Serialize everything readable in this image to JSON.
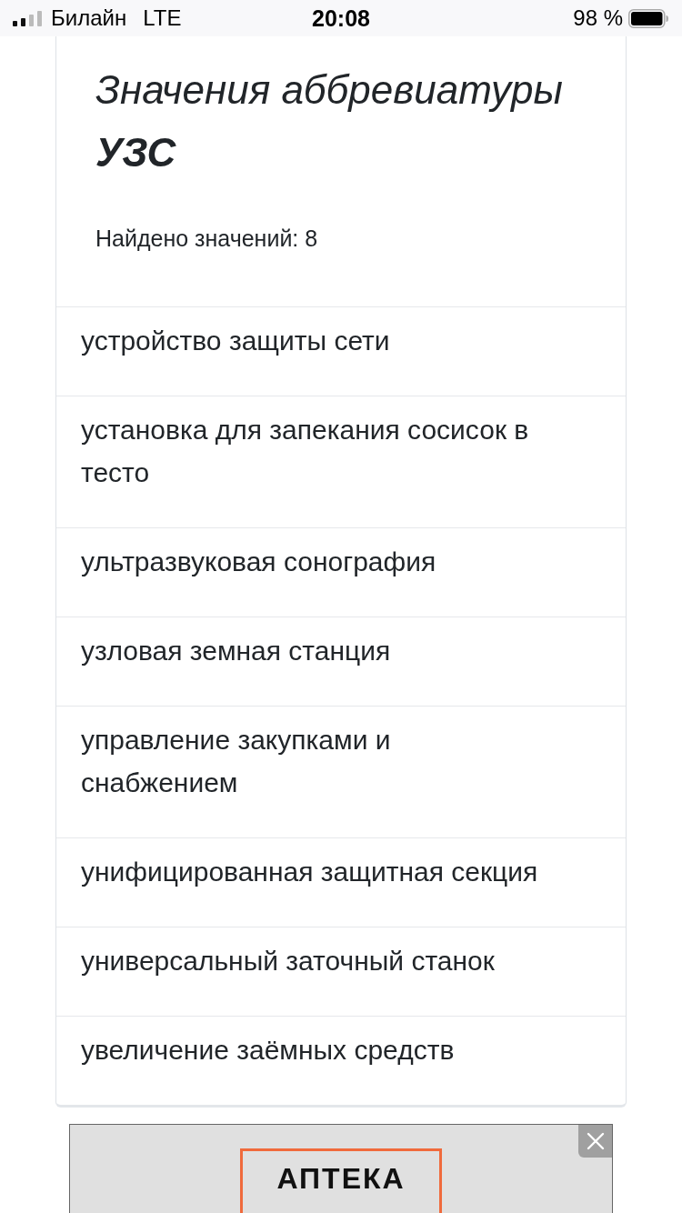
{
  "status_bar": {
    "carrier": "Билайн",
    "network": "LTE",
    "time": "20:08",
    "battery": "98 %"
  },
  "card": {
    "title": "Значения аббревиатуры **УЗС**",
    "count": "Найдено значений: 8",
    "meanings": [
      "устройство защиты сети",
      "установка для запекания сосисок в тесто",
      "ультразвуковая сонография",
      "узловая земная станция",
      "управление закупками и снабжением",
      "унифицированная защитная секция",
      "универсальный заточный станок",
      "увеличение заёмных средств"
    ]
  },
  "ad": {
    "button": "АПТЕКА"
  }
}
